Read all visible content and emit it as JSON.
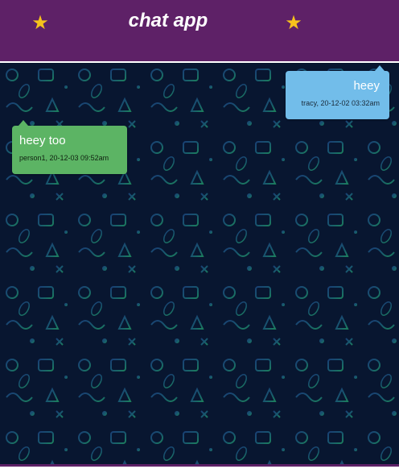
{
  "app": {
    "title": "chat app",
    "accent_color": "#5e2167",
    "star_icon": "star-icon"
  },
  "messages": [
    {
      "direction": "outgoing",
      "text": "heey",
      "sender": "tracy",
      "timestamp": "20-12-02 03:32am",
      "meta": "tracy, 20-12-02 03:32am",
      "color": "#72bdea"
    },
    {
      "direction": "incoming",
      "text": "heey too",
      "sender": "person1",
      "timestamp": "20-12-03 09:52am",
      "meta": "person1, 20-12-03 09:52am",
      "color": "#5cb464"
    }
  ]
}
